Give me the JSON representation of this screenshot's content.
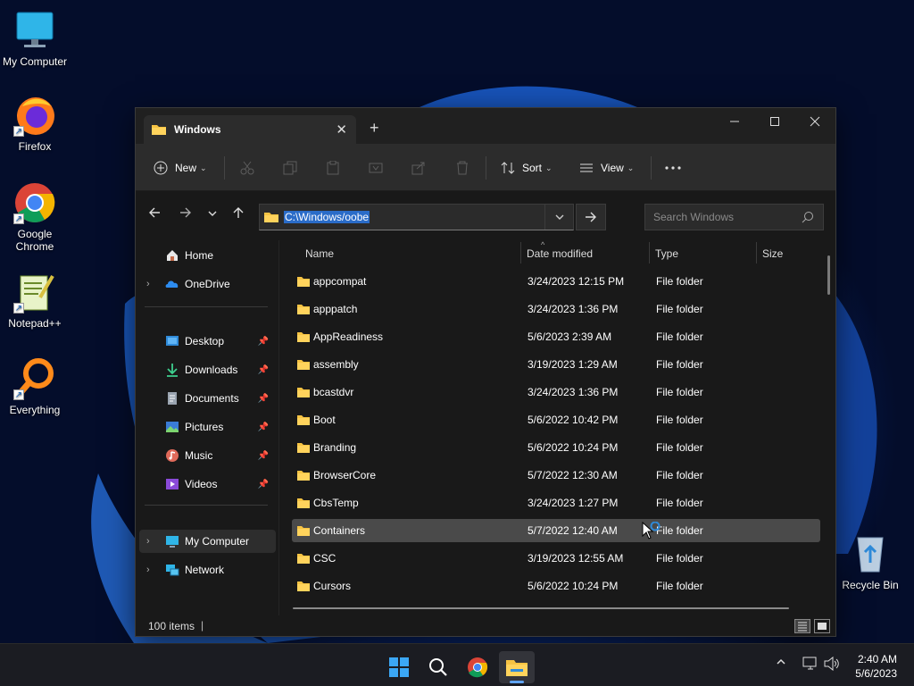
{
  "desktop": {
    "icons": [
      {
        "label": "My Computer"
      },
      {
        "label": "Firefox"
      },
      {
        "label": "Google Chrome"
      },
      {
        "label": "Notepad++"
      },
      {
        "label": "Everything"
      },
      {
        "label": "Recycle Bin"
      }
    ]
  },
  "window": {
    "tab_title": "Windows",
    "toolbar": {
      "new_label": "New",
      "sort_label": "Sort",
      "view_label": "View"
    },
    "address": {
      "path": "C:\\Windows/oobe"
    },
    "search": {
      "placeholder": "Search Windows"
    },
    "sidebar": {
      "items": [
        {
          "label": "Home",
          "icon": "home-icon"
        },
        {
          "label": "OneDrive",
          "icon": "onedrive-icon"
        },
        {
          "label": "Desktop",
          "icon": "desktop-folder-icon"
        },
        {
          "label": "Downloads",
          "icon": "downloads-icon"
        },
        {
          "label": "Documents",
          "icon": "documents-icon"
        },
        {
          "label": "Pictures",
          "icon": "pictures-icon"
        },
        {
          "label": "Music",
          "icon": "music-icon"
        },
        {
          "label": "Videos",
          "icon": "videos-icon"
        },
        {
          "label": "My Computer",
          "icon": "computer-icon"
        },
        {
          "label": "Network",
          "icon": "network-icon"
        }
      ]
    },
    "columns": {
      "name": "Name",
      "date": "Date modified",
      "type": "Type",
      "size": "Size"
    },
    "files": [
      {
        "name": "appcompat",
        "date": "3/24/2023 12:15 PM",
        "type": "File folder"
      },
      {
        "name": "apppatch",
        "date": "3/24/2023 1:36 PM",
        "type": "File folder"
      },
      {
        "name": "AppReadiness",
        "date": "5/6/2023 2:39 AM",
        "type": "File folder"
      },
      {
        "name": "assembly",
        "date": "3/19/2023 1:29 AM",
        "type": "File folder"
      },
      {
        "name": "bcastdvr",
        "date": "3/24/2023 1:36 PM",
        "type": "File folder"
      },
      {
        "name": "Boot",
        "date": "5/6/2022 10:42 PM",
        "type": "File folder"
      },
      {
        "name": "Branding",
        "date": "5/6/2022 10:24 PM",
        "type": "File folder"
      },
      {
        "name": "BrowserCore",
        "date": "5/7/2022 12:30 AM",
        "type": "File folder"
      },
      {
        "name": "CbsTemp",
        "date": "3/24/2023 1:27 PM",
        "type": "File folder"
      },
      {
        "name": "Containers",
        "date": "5/7/2022 12:40 AM",
        "type": "File folder"
      },
      {
        "name": "CSC",
        "date": "3/19/2023 12:55 AM",
        "type": "File folder"
      },
      {
        "name": "Cursors",
        "date": "5/6/2022 10:24 PM",
        "type": "File folder"
      }
    ],
    "status": {
      "item_count": "100 items"
    }
  },
  "taskbar": {
    "clock_time": "2:40 AM",
    "clock_date": "5/6/2023"
  },
  "colors": {
    "accent": "#60a5fa",
    "folder": "#f6c343",
    "selection": "#2a6cc8"
  }
}
